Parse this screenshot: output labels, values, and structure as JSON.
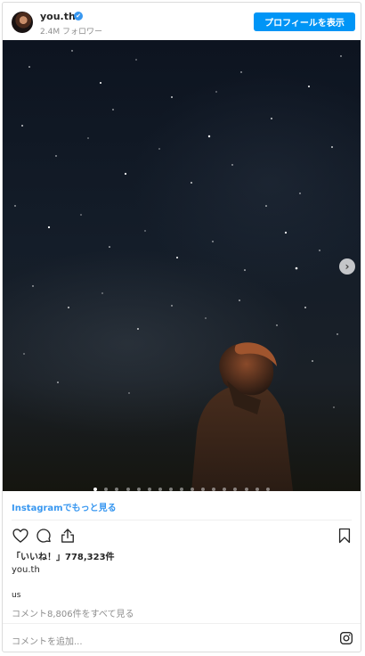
{
  "header": {
    "username": "you.th",
    "verified_badge": "✔",
    "followers": "2.4M フォロワー",
    "profile_button": "プロフィールを表示"
  },
  "post": {
    "carousel": {
      "total": 17,
      "current": 1
    },
    "next_icon": "chevron-right-icon"
  },
  "more_link": "Instagramでもっと見る",
  "actions": {
    "icons": [
      "heart-icon",
      "comment-icon",
      "share-icon",
      "bookmark-icon"
    ]
  },
  "likes": {
    "label": "「いいね！」",
    "count": "778,323件"
  },
  "caption": {
    "username": "you.th",
    "text": "us"
  },
  "view_comments": "コメント8,806件をすべて見る",
  "comment_placeholder": "コメントを追加...",
  "colors": {
    "accent": "#0095f6",
    "link": "#3897f0",
    "muted": "#8e8e8e",
    "text": "#262626"
  }
}
